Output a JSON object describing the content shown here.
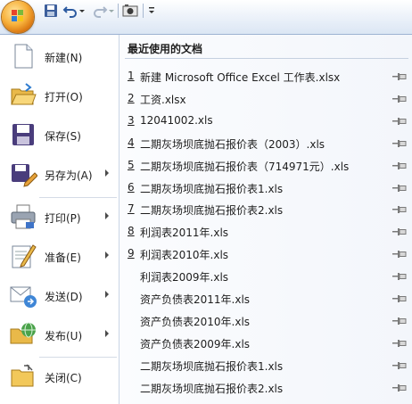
{
  "left_menu": [
    {
      "label": "新建(N)",
      "key": "new",
      "icon": "new-document-icon",
      "arrow": false
    },
    {
      "label": "打开(O)",
      "key": "open",
      "icon": "open-folder-icon",
      "arrow": false
    },
    {
      "label": "保存(S)",
      "key": "save",
      "icon": "save-disk-icon",
      "arrow": false
    },
    {
      "label": "另存为(A)",
      "key": "saveas",
      "icon": "save-as-icon",
      "arrow": true
    },
    {
      "label": "打印(P)",
      "key": "print",
      "icon": "printer-icon",
      "arrow": true
    },
    {
      "label": "准备(E)",
      "key": "prepare",
      "icon": "prepare-pencil-icon",
      "arrow": true
    },
    {
      "label": "发送(D)",
      "key": "send",
      "icon": "send-icon",
      "arrow": true
    },
    {
      "label": "发布(U)",
      "key": "publish",
      "icon": "publish-icon",
      "arrow": true
    },
    {
      "label": "关闭(C)",
      "key": "close",
      "icon": "close-folder-icon",
      "arrow": false
    }
  ],
  "recent": {
    "title": "最近使用的文档",
    "items": [
      {
        "num": "1",
        "name": "新建 Microsoft Office Excel 工作表.xlsx"
      },
      {
        "num": "2",
        "name": "工资.xlsx"
      },
      {
        "num": "3",
        "name": "12041002.xls"
      },
      {
        "num": "4",
        "name": "二期灰场坝底抛石报价表（2003）.xls"
      },
      {
        "num": "5",
        "name": "二期灰场坝底抛石报价表（714971元）.xls"
      },
      {
        "num": "6",
        "name": "二期灰场坝底抛石报价表1.xls"
      },
      {
        "num": "7",
        "name": "二期灰场坝底抛石报价表2.xls"
      },
      {
        "num": "8",
        "name": "利润表2011年.xls"
      },
      {
        "num": "9",
        "name": "利润表2010年.xls"
      },
      {
        "num": "",
        "name": "利润表2009年.xls"
      },
      {
        "num": "",
        "name": "资产负债表2011年.xls"
      },
      {
        "num": "",
        "name": "资产负债表2010年.xls"
      },
      {
        "num": "",
        "name": "资产负债表2009年.xls"
      },
      {
        "num": "",
        "name": "二期灰场坝底抛石报价表1.xls"
      },
      {
        "num": "",
        "name": "二期灰场坝底抛石报价表2.xls"
      }
    ]
  },
  "colors": {
    "accent": "#f7b03a",
    "panel_border": "#9db3d2",
    "pin": "#7a7a7a"
  }
}
